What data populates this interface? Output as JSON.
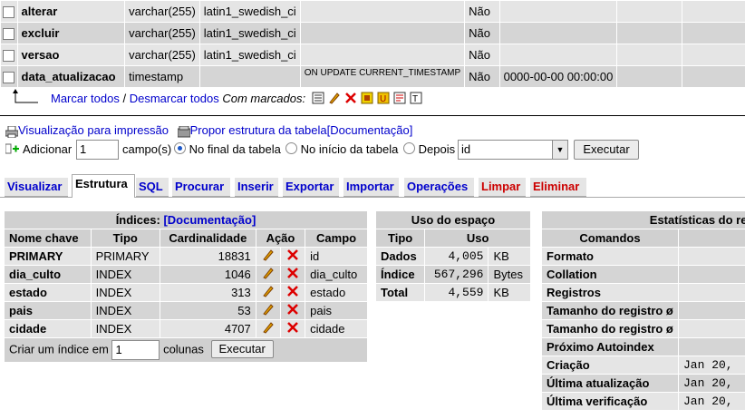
{
  "fields": [
    {
      "name": "alterar",
      "type": "varchar(255)",
      "collation": "latin1_swedish_ci",
      "attributes": "",
      "null": "Não",
      "default": ""
    },
    {
      "name": "excluir",
      "type": "varchar(255)",
      "collation": "latin1_swedish_ci",
      "attributes": "",
      "null": "Não",
      "default": ""
    },
    {
      "name": "versao",
      "type": "varchar(255)",
      "collation": "latin1_swedish_ci",
      "attributes": "",
      "null": "Não",
      "default": ""
    },
    {
      "name": "data_atualizacao",
      "type": "timestamp",
      "collation": "",
      "attributes": "ON UPDATE CURRENT_TIMESTAMP",
      "null": "Não",
      "default": "0000-00-00 00:00:00"
    }
  ],
  "bulk": {
    "check_all": "Marcar todos",
    "separator": " / ",
    "uncheck_all": "Desmarcar todos",
    "with_selected": "Com marcados:"
  },
  "actions": {
    "print_view": "Visualização para impressão",
    "propose": "Propor estrutura da tabela",
    "doc": "[Documentação]"
  },
  "add_field": {
    "label": "Adicionar",
    "count": "1",
    "fields_label": "campo(s)",
    "at_end": "No final da tabela",
    "at_start": "No início da tabela",
    "after": "Depois",
    "after_value": "id",
    "submit": "Executar"
  },
  "tabs": [
    "Visualizar",
    "Estrutura",
    "SQL",
    "Procurar",
    "Inserir",
    "Exportar",
    "Importar",
    "Operações",
    "Limpar",
    "Eliminar"
  ],
  "indexes": {
    "title": "Índices:",
    "doc": "[Documentação]",
    "headers": [
      "Nome chave",
      "Tipo",
      "Cardinalidade",
      "Ação",
      "Campo"
    ],
    "rows": [
      {
        "name": "PRIMARY",
        "type": "PRIMARY",
        "card": "18831",
        "field": "id"
      },
      {
        "name": "dia_culto",
        "type": "INDEX",
        "card": "1046",
        "field": "dia_culto"
      },
      {
        "name": "estado",
        "type": "INDEX",
        "card": "313",
        "field": "estado"
      },
      {
        "name": "pais",
        "type": "INDEX",
        "card": "53",
        "field": "pais"
      },
      {
        "name": "cidade",
        "type": "INDEX",
        "card": "4707",
        "field": "cidade"
      }
    ],
    "create_label": "Criar um índice em",
    "create_count": "1",
    "create_cols": "colunas",
    "create_submit": "Executar"
  },
  "space": {
    "title": "Uso do espaço",
    "headers": [
      "Tipo",
      "Uso"
    ],
    "rows": [
      {
        "type": "Dados",
        "value": "4,005",
        "unit": "KB"
      },
      {
        "type": "Índice",
        "value": "567,296",
        "unit": "Bytes"
      },
      {
        "type": "Total",
        "value": "4,559",
        "unit": "KB"
      }
    ]
  },
  "stats": {
    "title": "Estatísticas do regi",
    "header": "Comandos",
    "rows": [
      {
        "label": "Formato",
        "value": ""
      },
      {
        "label": "Collation",
        "value": ""
      },
      {
        "label": "Registros",
        "value": ""
      },
      {
        "label": "Tamanho do registro ø",
        "value": ""
      },
      {
        "label": "Tamanho do registro ø",
        "value": ""
      },
      {
        "label": "Próximo Autoindex",
        "value": ""
      },
      {
        "label": "Criação",
        "value": "Jan 20,"
      },
      {
        "label": "Última atualização",
        "value": "Jan 20,"
      },
      {
        "label": "Última verificação",
        "value": "Jan 20,"
      }
    ]
  }
}
